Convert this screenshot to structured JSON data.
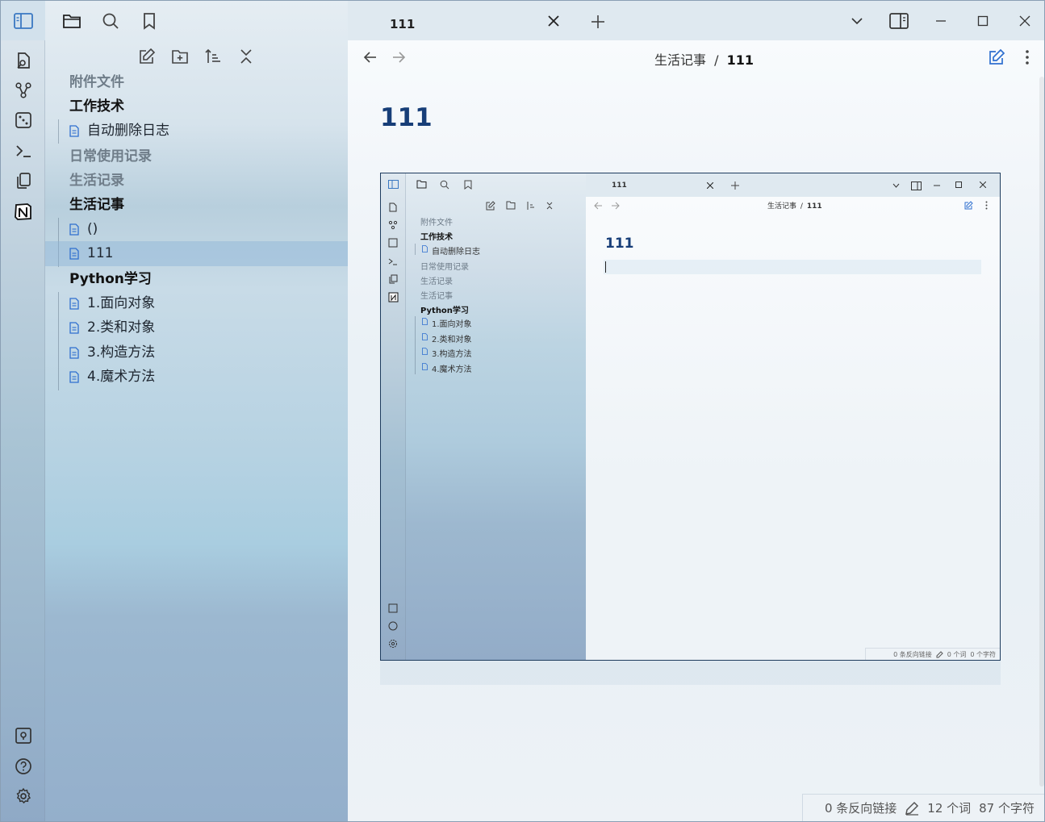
{
  "window": {
    "tab_title": "111"
  },
  "ribbon": {
    "icons": [
      "panel-toggle-icon",
      "open-quick-switcher-icon",
      "graph-view-icon",
      "random-note-icon",
      "command-palette-icon",
      "templates-icon",
      "notion-icon",
      "vault-switcher-icon",
      "help-icon",
      "settings-icon"
    ]
  },
  "sidebar": {
    "header_icons": [
      "folder-icon",
      "search-icon",
      "bookmark-icon"
    ],
    "tools": [
      "new-note-icon",
      "new-folder-icon",
      "sort-icon",
      "collapse-all-icon"
    ],
    "tree": [
      {
        "type": "folder",
        "label": "附件文件",
        "muted": true
      },
      {
        "type": "folder",
        "label": "工作技术",
        "muted": false
      },
      {
        "type": "file",
        "label": "自动删除日志"
      },
      {
        "type": "folder",
        "label": "日常使用记录",
        "muted": true
      },
      {
        "type": "folder",
        "label": "生活记录",
        "muted": true
      },
      {
        "type": "folder",
        "label": "生活记事",
        "muted": false
      },
      {
        "type": "file",
        "label": "()"
      },
      {
        "type": "file",
        "label": "111",
        "active": true
      },
      {
        "type": "folder",
        "label": "Python学习",
        "muted": false
      },
      {
        "type": "file",
        "label": "1.面向对象"
      },
      {
        "type": "file",
        "label": "2.类和对象"
      },
      {
        "type": "file",
        "label": "3.构造方法"
      },
      {
        "type": "file",
        "label": "4.魔术方法"
      }
    ]
  },
  "main": {
    "breadcrumb_parent": "生活记事",
    "breadcrumb_sep": "/",
    "breadcrumb_current": "111",
    "note_title": "111"
  },
  "embedded": {
    "tab_title": "111",
    "breadcrumb_parent": "生活记事",
    "breadcrumb_sep": "/",
    "breadcrumb_current": "111",
    "note_title": "111",
    "tree": [
      "附件文件",
      "工作技术",
      "自动删除日志",
      "日常使用记录",
      "生活记录",
      "生活记事",
      "Python学习",
      "1.面向对象",
      "2.类和对象",
      "3.构造方法",
      "4.魔术方法"
    ],
    "status_backlinks": "0 条反向链接",
    "status_words": "0 个词",
    "status_chars": "0 个字符"
  },
  "status": {
    "backlinks": "0 条反向链接",
    "words": "12 个词",
    "chars": "87 个字符"
  },
  "colors": {
    "accent": "#2f6fcf",
    "title": "#173e78"
  }
}
